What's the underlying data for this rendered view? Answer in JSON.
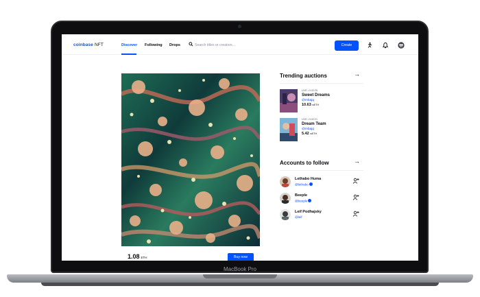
{
  "device": {
    "chin_label": "MacBook Pro"
  },
  "nav": {
    "logo": "coinbase",
    "logo_suffix": "NFT",
    "tabs": [
      {
        "label": "Discover",
        "active": true
      },
      {
        "label": "Following",
        "active": false
      },
      {
        "label": "Drops",
        "active": false
      }
    ],
    "search_placeholder": "Search titles or creators...",
    "create_label": "Create",
    "icons": [
      "search-icon",
      "activity-icon",
      "bell-icon",
      "profile-avatar"
    ]
  },
  "featured": {
    "price": "1.08",
    "price_unit": "ETH",
    "buy_label": "Buy now"
  },
  "trending": {
    "title": "Trending auctions",
    "items": [
      {
        "live": "LIVE • 0:02:25",
        "title": "Sweet Dreams",
        "handle": "@mbajq",
        "price": "10.63",
        "unit": "wETH"
      },
      {
        "live": "LIVE • 0:02:21",
        "title": "Dream Team",
        "handle": "@mbajq",
        "price": "5.42",
        "unit": "wETH"
      }
    ]
  },
  "accounts": {
    "title": "Accounts to follow",
    "items": [
      {
        "name": "Lethabo Huma",
        "handle": "@lethabo",
        "verified": true
      },
      {
        "name": "Beeple",
        "handle": "@beeple",
        "verified": true
      },
      {
        "name": "Leif Podhajsky",
        "handle": "@leif",
        "verified": false
      }
    ]
  },
  "colors": {
    "brand": "#0052ff",
    "text": "#0a0b0d",
    "muted": "#5b616e"
  }
}
